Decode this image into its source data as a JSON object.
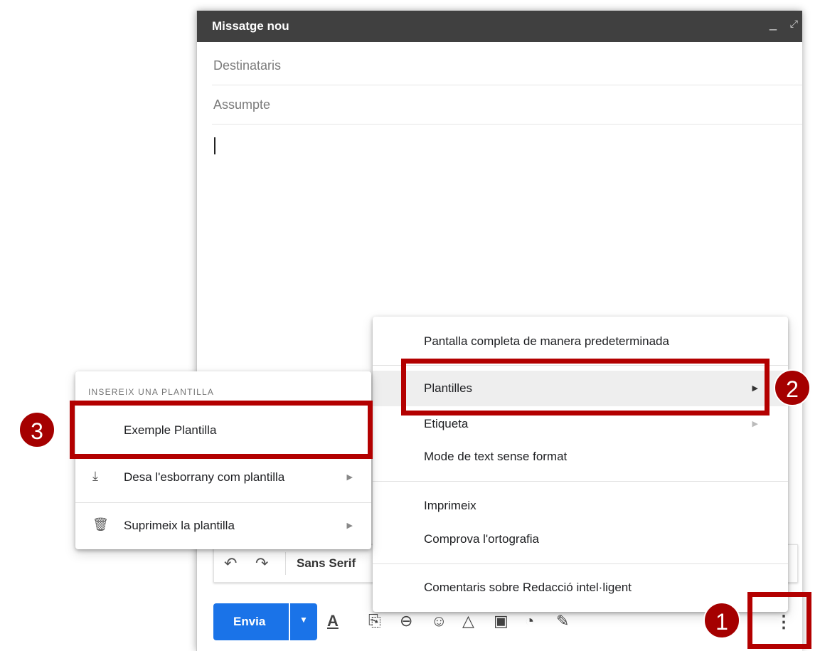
{
  "compose": {
    "title": "Missatge nou",
    "minimize_glyph": "_",
    "expand_glyph": "⤢",
    "to_placeholder": "Destinataris",
    "subject_placeholder": "Assumpte"
  },
  "format_bar": {
    "undo_glyph": "↶",
    "redo_glyph": "↷",
    "font": "Sans Serif"
  },
  "send_row": {
    "send_label": "Envia",
    "dropdown_glyph": "▼",
    "more_glyph": "⋮",
    "tool_icons": [
      "text-format-icon",
      "attach-icon",
      "link-icon",
      "emoji-icon",
      "drive-icon",
      "photo-icon",
      "confidential-icon",
      "signature-icon"
    ],
    "tool_glyphs": [
      "A",
      "⎘",
      "⊖",
      "☺",
      "△",
      "▣",
      "◔",
      "✎"
    ]
  },
  "more_menu": {
    "items": [
      {
        "label": "Pantalla completa de manera predeterminada"
      },
      {
        "label": "Plantilles",
        "arrow": "▶"
      },
      {
        "label": "Etiqueta",
        "arrow": "▶"
      },
      {
        "label": "Mode de text sense format"
      },
      {
        "label": "Imprimeix"
      },
      {
        "label": "Comprova l'ortografia"
      },
      {
        "label": "Comentaris sobre Redacció intel·ligent"
      }
    ]
  },
  "templates_menu": {
    "header": "INSEREIX UNA PLANTILLA",
    "items": [
      {
        "label": "Exemple Plantilla"
      },
      {
        "label": "Desa l'esborrany com plantilla",
        "icon": "download-icon",
        "glyph": "⤓",
        "arrow": "▶"
      },
      {
        "label": "Suprimeix la plantilla",
        "icon": "trash-icon",
        "glyph": "🗑",
        "arrow": "▶"
      }
    ]
  },
  "callouts": {
    "one": "1",
    "two": "2",
    "three": "3",
    "color": "#b30000"
  }
}
